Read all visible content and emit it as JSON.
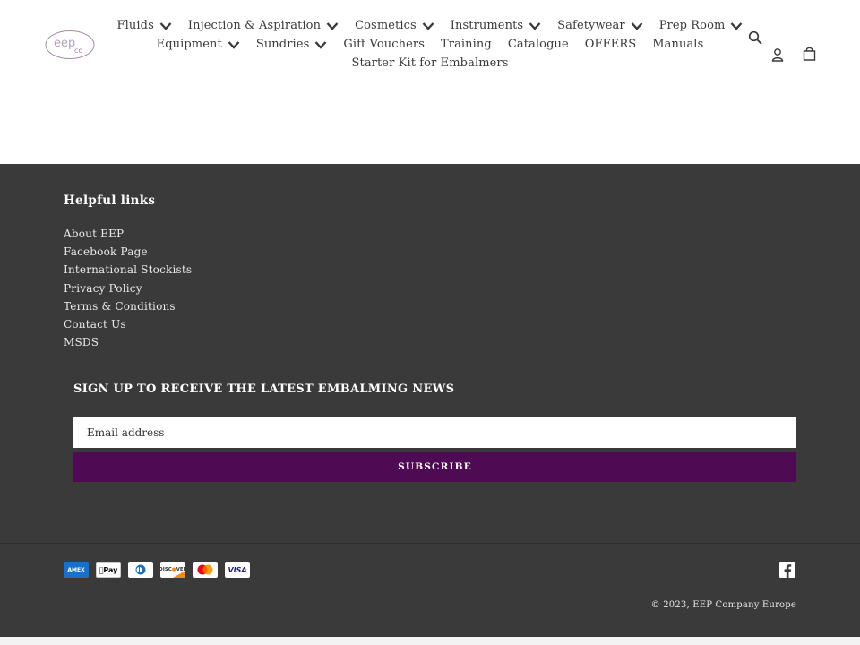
{
  "brand": {
    "logo_text": "eep",
    "logo_sub": "co"
  },
  "nav": {
    "rows": [
      [
        {
          "label": "Fluids",
          "dropdown": true
        },
        {
          "label": "Injection & Aspiration",
          "dropdown": true
        },
        {
          "label": "Cosmetics",
          "dropdown": true
        },
        {
          "label": "Instruments",
          "dropdown": true
        },
        {
          "label": "Safetywear",
          "dropdown": true
        },
        {
          "label": "Prep Room",
          "dropdown": true
        }
      ],
      [
        {
          "label": "Equipment",
          "dropdown": true
        },
        {
          "label": "Sundries",
          "dropdown": true
        },
        {
          "label": "Gift Vouchers",
          "dropdown": false
        },
        {
          "label": "Training",
          "dropdown": false
        },
        {
          "label": "Catalogue",
          "dropdown": false
        },
        {
          "label": "OFFERS",
          "dropdown": false
        },
        {
          "label": "Manuals",
          "dropdown": false
        }
      ],
      [
        {
          "label": "Starter Kit for Embalmers",
          "dropdown": false
        }
      ]
    ]
  },
  "header_icons": {
    "search": "search-icon",
    "account": "user-icon",
    "cart": "shopping-bag-icon"
  },
  "footer": {
    "links_title": "Helpful links",
    "links": [
      "About EEP",
      "Facebook Page",
      "International Stockists",
      "Privacy Policy",
      "Terms & Conditions",
      "Contact Us",
      "MSDS"
    ],
    "signup_title": "SIGN UP TO RECEIVE THE LATEST EMBALMING NEWS",
    "email_placeholder": "Email address",
    "subscribe_label": "SUBSCRIBE",
    "payments": [
      "American Express",
      "Apple Pay",
      "Diners Club",
      "Discover",
      "Mastercard",
      "Visa"
    ],
    "copyright": "© 2023, EEP Company Europe",
    "social": "facebook-icon"
  },
  "colors": {
    "footer_bg": "#3a3a3a",
    "accent": "#4e0a52",
    "text": "#3a3a3a"
  }
}
